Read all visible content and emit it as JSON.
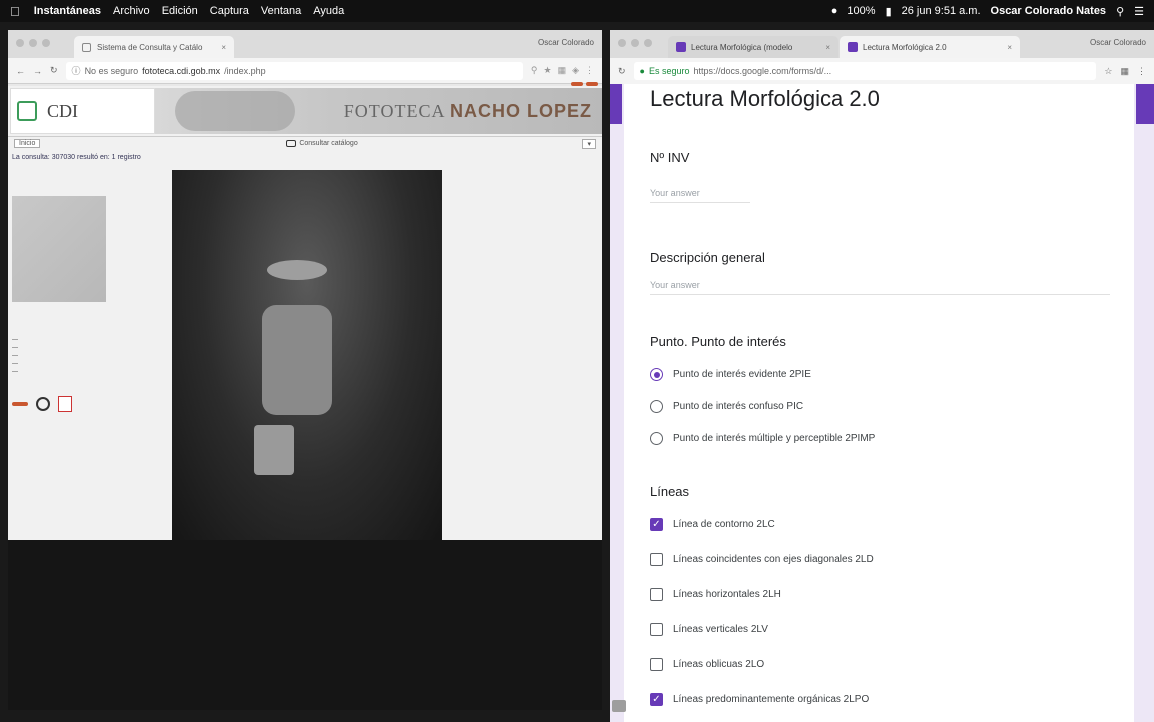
{
  "menubar": {
    "app": "Instantáneas",
    "items": [
      "Archivo",
      "Edición",
      "Captura",
      "Ventana",
      "Ayuda"
    ],
    "battery": "100%",
    "datetime": "26 jun 9:51 a.m.",
    "user": "Oscar Colorado Nates"
  },
  "left_browser": {
    "tab_title": "Sistema de Consulta y Catálo",
    "user": "Oscar Colorado",
    "security": "No es seguro",
    "url_domain": "fototeca.cdi.gob.mx",
    "url_path": "/index.php",
    "site": {
      "logo": "CDI",
      "brand_prefix": "FOTOTECA ",
      "brand_name": "NACHO LOPEZ",
      "select_label": "Inicio",
      "catalog_label": "Consultar catálogo",
      "result_text": "La consulta: 307030 resultó en: 1 registro"
    }
  },
  "right_browser": {
    "tab1_title": "Lectura Morfológica (modelo",
    "tab2_title": "Lectura Morfológica 2.0",
    "user": "Oscar Colorado",
    "security": "Es seguro",
    "url": "https://docs.google.com/forms/d/...",
    "form": {
      "title": "Lectura Morfológica 2.0",
      "q1": {
        "title": "Nº INV",
        "placeholder": "Your answer"
      },
      "q2": {
        "title": "Descripción general",
        "placeholder": "Your answer"
      },
      "q3": {
        "title": "Punto. Punto de interés",
        "options": [
          {
            "label": "Punto de interés evidente 2PIE",
            "selected": true
          },
          {
            "label": "Punto de interés confuso PIC",
            "selected": false
          },
          {
            "label": "Punto de interés múltiple y perceptible 2PIMP",
            "selected": false
          }
        ]
      },
      "q4": {
        "title": "Líneas",
        "options": [
          {
            "label": "Línea de contorno 2LC",
            "checked": true
          },
          {
            "label": "Líneas coincidentes con ejes diagonales 2LD",
            "checked": false
          },
          {
            "label": "Líneas horizontales 2LH",
            "checked": false
          },
          {
            "label": "Líneas verticales 2LV",
            "checked": false
          },
          {
            "label": "Líneas oblicuas 2LO",
            "checked": false
          },
          {
            "label": "Líneas predominantemente orgánicas 2LPO",
            "checked": true
          }
        ]
      }
    }
  },
  "colors": {
    "accent": "#673ab7",
    "form_bg": "#ede7f6",
    "secure": "#1a8a3c"
  }
}
